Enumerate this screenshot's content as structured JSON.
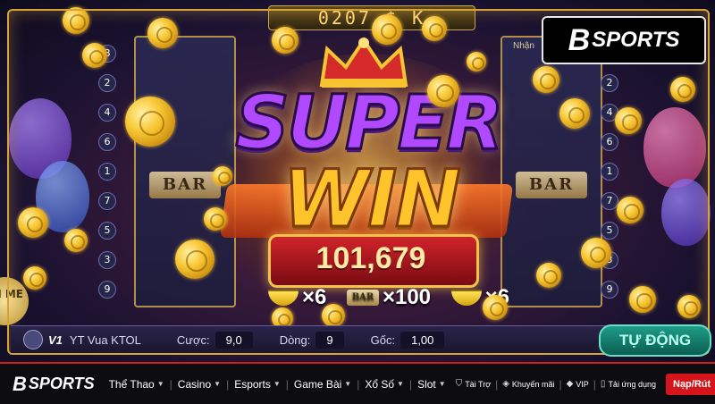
{
  "game": {
    "top_counter": "0207 $ K",
    "banner_line1": "SUPER",
    "banner_line2": "WIN",
    "win_amount": "101,679",
    "bar_symbol": "BAR",
    "reel_numbers_left": [
      "8",
      "2",
      "4",
      "6",
      "1",
      "7",
      "5",
      "3",
      "9"
    ],
    "reel_numbers_right": [
      "8",
      "2",
      "4",
      "6",
      "1",
      "7",
      "5",
      "3",
      "9"
    ],
    "combos": [
      {
        "symbol": "banana",
        "multiplier": "×6"
      },
      {
        "symbol": "BAR",
        "multiplier": "×100"
      },
      {
        "symbol": "banana",
        "multiplier": "×6"
      }
    ],
    "nhan_label": "Nhận",
    "side_button_label": "NI ME",
    "player_vip": "V1",
    "player_name": "YT Vua KTOL",
    "bet_label": "Cược:",
    "bet_value": "9,0",
    "lines_label": "Dòng:",
    "lines_value": "9",
    "base_label": "Gốc:",
    "base_value": "1,00",
    "auto_button": "TỰ ĐỘNG",
    "colors": {
      "accent": "#d6141c",
      "gold": "#ffc42b",
      "purple": "#b049ff"
    }
  },
  "logo_badge": {
    "mark": "B",
    "text": "SPORTS"
  },
  "navbar": {
    "logo_mark": "B",
    "logo_text": "SPORTS",
    "items": [
      "Thể Thao",
      "Casino",
      "Esports",
      "Game Bài",
      "Xổ Số",
      "Slot"
    ],
    "right_links": [
      "Tài Trợ",
      "Khuyến mãi",
      "VIP",
      "Tải ứng dụng"
    ],
    "deposit_button": "Nạp/Rút"
  }
}
